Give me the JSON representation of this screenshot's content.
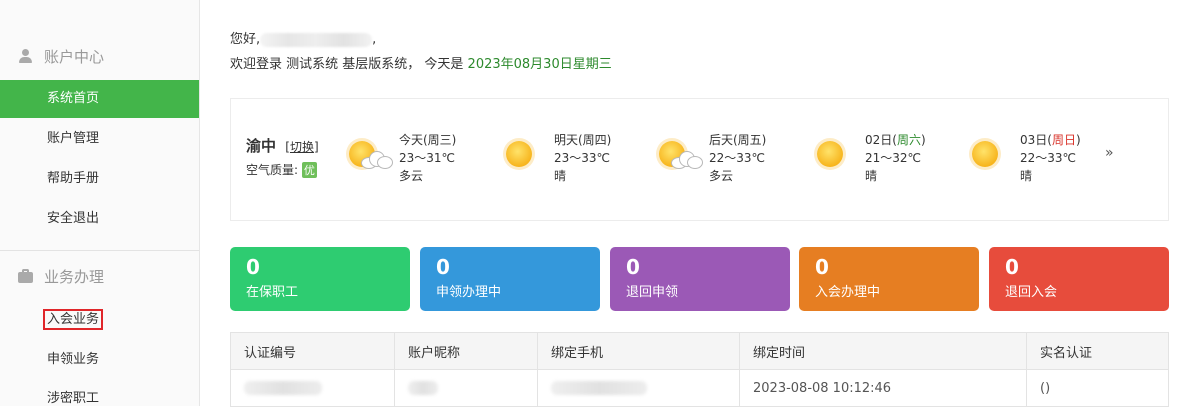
{
  "sidebar": {
    "sections": [
      {
        "title": "账户中心",
        "icon": "user-icon",
        "items": [
          {
            "label": "系统首页",
            "active": true
          },
          {
            "label": "账户管理"
          },
          {
            "label": "帮助手册"
          },
          {
            "label": "安全退出"
          }
        ]
      },
      {
        "title": "业务办理",
        "icon": "briefcase-icon",
        "items": [
          {
            "label": "入会业务",
            "highlighted": true
          },
          {
            "label": "申领业务"
          },
          {
            "label": "涉密职工"
          }
        ]
      }
    ]
  },
  "greeting": {
    "hello": "您好,",
    "welcome_prefix": "欢迎登录 测试系统 基层版系统， 今天是",
    "date": "2023年08月30日星期三"
  },
  "weather": {
    "city": "渝中",
    "switch_label": "切换",
    "air_label": "空气质量:",
    "air_value": "优",
    "days": [
      {
        "label": "今天(周三)",
        "temp": "23～31℃",
        "desc": "多云",
        "icon": "partly-cloudy-icon"
      },
      {
        "label": "明天(周四)",
        "temp": "23～33℃",
        "desc": "晴",
        "icon": "sunny-icon"
      },
      {
        "label": "后天(周五)",
        "temp": "22～33℃",
        "desc": "多云",
        "icon": "partly-cloudy-icon"
      },
      {
        "date": "02日",
        "weekday": "周六",
        "temp": "21～32℃",
        "desc": "晴",
        "icon": "sunny-icon"
      },
      {
        "date": "03日",
        "weekday": "周日",
        "temp": "22～33℃",
        "desc": "晴",
        "icon": "sunny-icon"
      }
    ],
    "more_label": "»"
  },
  "stats": [
    {
      "value": "0",
      "label": "在保职工",
      "color": "#2ecc71"
    },
    {
      "value": "0",
      "label": "申领办理中",
      "color": "#3498db"
    },
    {
      "value": "0",
      "label": "退回申领",
      "color": "#9b59b6"
    },
    {
      "value": "0",
      "label": "入会办理中",
      "color": "#e67e22"
    },
    {
      "value": "0",
      "label": "退回入会",
      "color": "#e74c3c"
    }
  ],
  "table": {
    "columns": [
      "认证编号",
      "账户昵称",
      "绑定手机",
      "绑定时间",
      "实名认证"
    ],
    "rows": [
      {
        "bind_time": "2023-08-08 10:12:46",
        "realname": "()"
      }
    ]
  }
}
